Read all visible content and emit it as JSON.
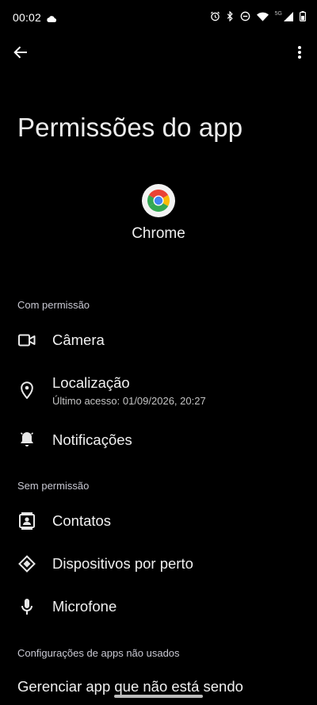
{
  "status": {
    "time": "00:02",
    "network_label": "5G",
    "icons": [
      "cloud-icon",
      "alarm-icon",
      "bluetooth-icon",
      "dnd-icon",
      "wifi-icon",
      "signal-icon",
      "battery-icon"
    ]
  },
  "toolbar": {
    "back_icon": "arrow-left-icon",
    "more_icon": "more-vert-icon"
  },
  "page": {
    "title": "Permissões do app",
    "app_name": "Chrome"
  },
  "sections": {
    "allowed": {
      "header": "Com permissão",
      "items": [
        {
          "label": "Câmera",
          "icon": "camera-icon"
        },
        {
          "label": "Localização",
          "sub": "Último acesso: 01/09/2026, 20:27",
          "icon": "location-icon"
        },
        {
          "label": "Notificações",
          "icon": "bell-icon"
        }
      ]
    },
    "denied": {
      "header": "Sem permissão",
      "items": [
        {
          "label": "Contatos",
          "icon": "contacts-icon"
        },
        {
          "label": "Dispositivos por perto",
          "icon": "nearby-devices-icon"
        },
        {
          "label": "Microfone",
          "icon": "mic-icon"
        }
      ]
    },
    "unused": {
      "header": "Configurações de apps não usados",
      "partial_item": "Gerenciar app que não está sendo"
    }
  },
  "colors": {
    "background": "#000000",
    "text_primary": "#f0f0f0",
    "text_secondary": "#c9c9d3"
  }
}
